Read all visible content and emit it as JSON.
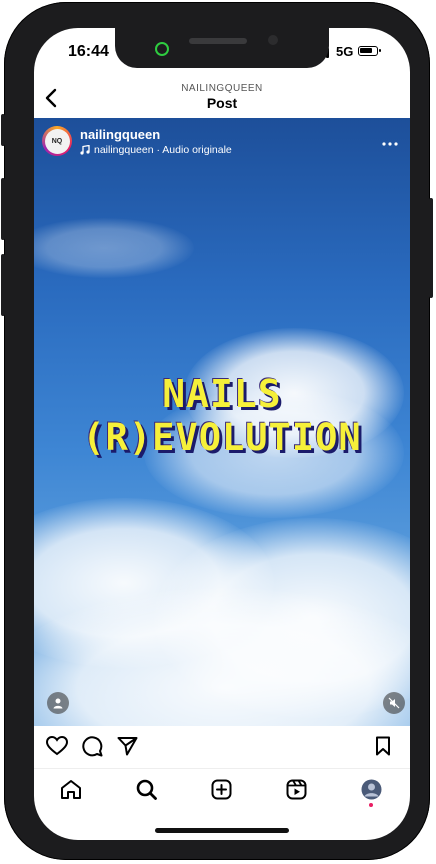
{
  "status_bar": {
    "time": "16:44",
    "network": "5G"
  },
  "header": {
    "username": "NAILINGQUEEN",
    "title": "Post"
  },
  "post": {
    "username": "nailingqueen",
    "audio": "nailingqueen · Audio originale",
    "avatar_initials": "NQ",
    "overlay_line1": "NAILS",
    "overlay_line2": "(R)EVOLUTION"
  },
  "icons": {
    "back": "chevron-left-icon",
    "more": "more-horizontal-icon",
    "like": "heart-icon",
    "comment": "comment-icon",
    "share": "send-icon",
    "save": "bookmark-icon",
    "tag": "user-tag-icon",
    "mute": "muted-speaker-icon",
    "home": "home-icon",
    "search": "search-icon",
    "create": "add-post-icon",
    "reels": "reels-icon",
    "profile": "profile-avatar-icon"
  },
  "colors": {
    "overlay_text": "#f6f03a",
    "notification_dot": "#e91e63"
  }
}
